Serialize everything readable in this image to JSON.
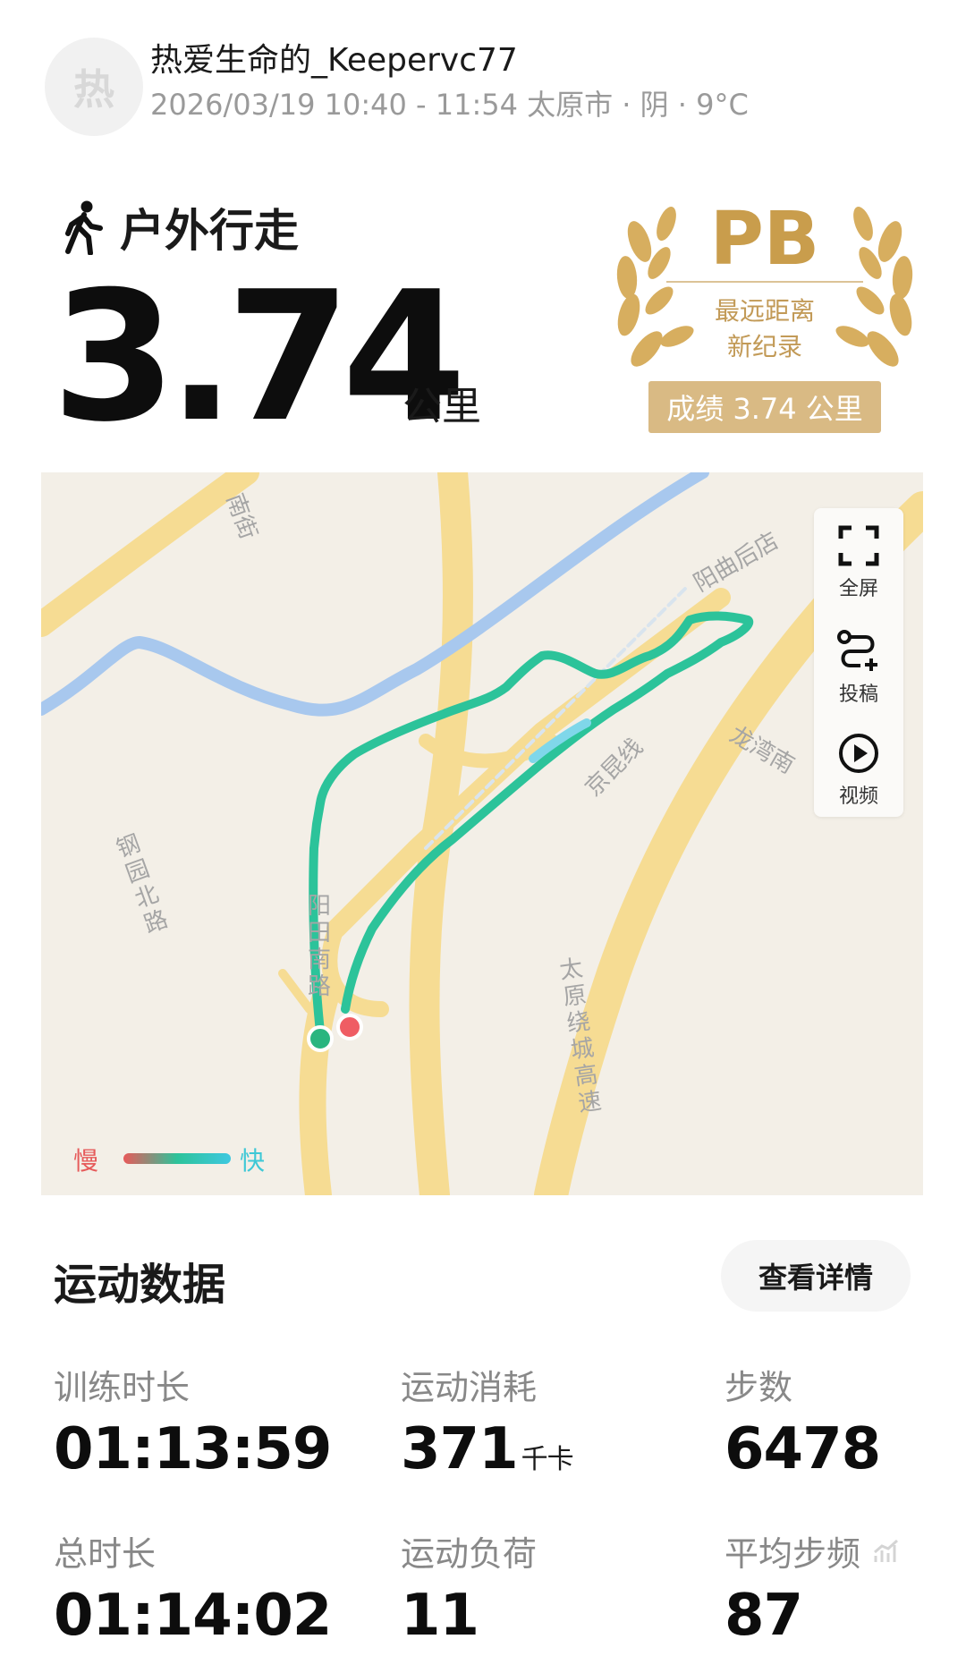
{
  "header": {
    "avatar_text": "热",
    "username": "热爱生命的_Keepervc77",
    "meta": "2026/03/19 10:40 - 11:54 太原市 · 阴 · 9°C"
  },
  "activity": {
    "icon": "walking-person-icon",
    "type": "户外行走",
    "distance": "3.74",
    "unit": "公里"
  },
  "badge": {
    "title": "PB",
    "line1": "最远距离",
    "line2": "新纪录",
    "result": "成绩 3.74 公里"
  },
  "map": {
    "labels": [
      "南街",
      "阳曲后店",
      "龙湾南",
      "京昆线",
      "钢园北路",
      "阳田南路",
      "太原绕城高速"
    ],
    "tools": [
      {
        "label": "全屏",
        "icon": "fullscreen-icon"
      },
      {
        "label": "投稿",
        "icon": "route-submit-icon"
      },
      {
        "label": "视频",
        "icon": "play-video-icon"
      }
    ],
    "legend": {
      "slow": "慢",
      "fast": "快"
    },
    "colors": {
      "route": "#2cc39a",
      "start": "#29b57f",
      "end": "#ef5d64",
      "road": "#f6dc93",
      "river": "#a8c8ee"
    }
  },
  "stats": {
    "section_title": "运动数据",
    "detail_button": "查看详情",
    "items": [
      {
        "label": "训练时长",
        "value": "01:13:59",
        "unit": ""
      },
      {
        "label": "运动消耗",
        "value": "371",
        "unit": "千卡"
      },
      {
        "label": "步数",
        "value": "6478",
        "unit": ""
      },
      {
        "label": "总时长",
        "value": "01:14:02",
        "unit": ""
      },
      {
        "label": "运动负荷",
        "value": "11",
        "unit": ""
      },
      {
        "label": "平均步频",
        "value": "87",
        "unit": ""
      }
    ]
  }
}
